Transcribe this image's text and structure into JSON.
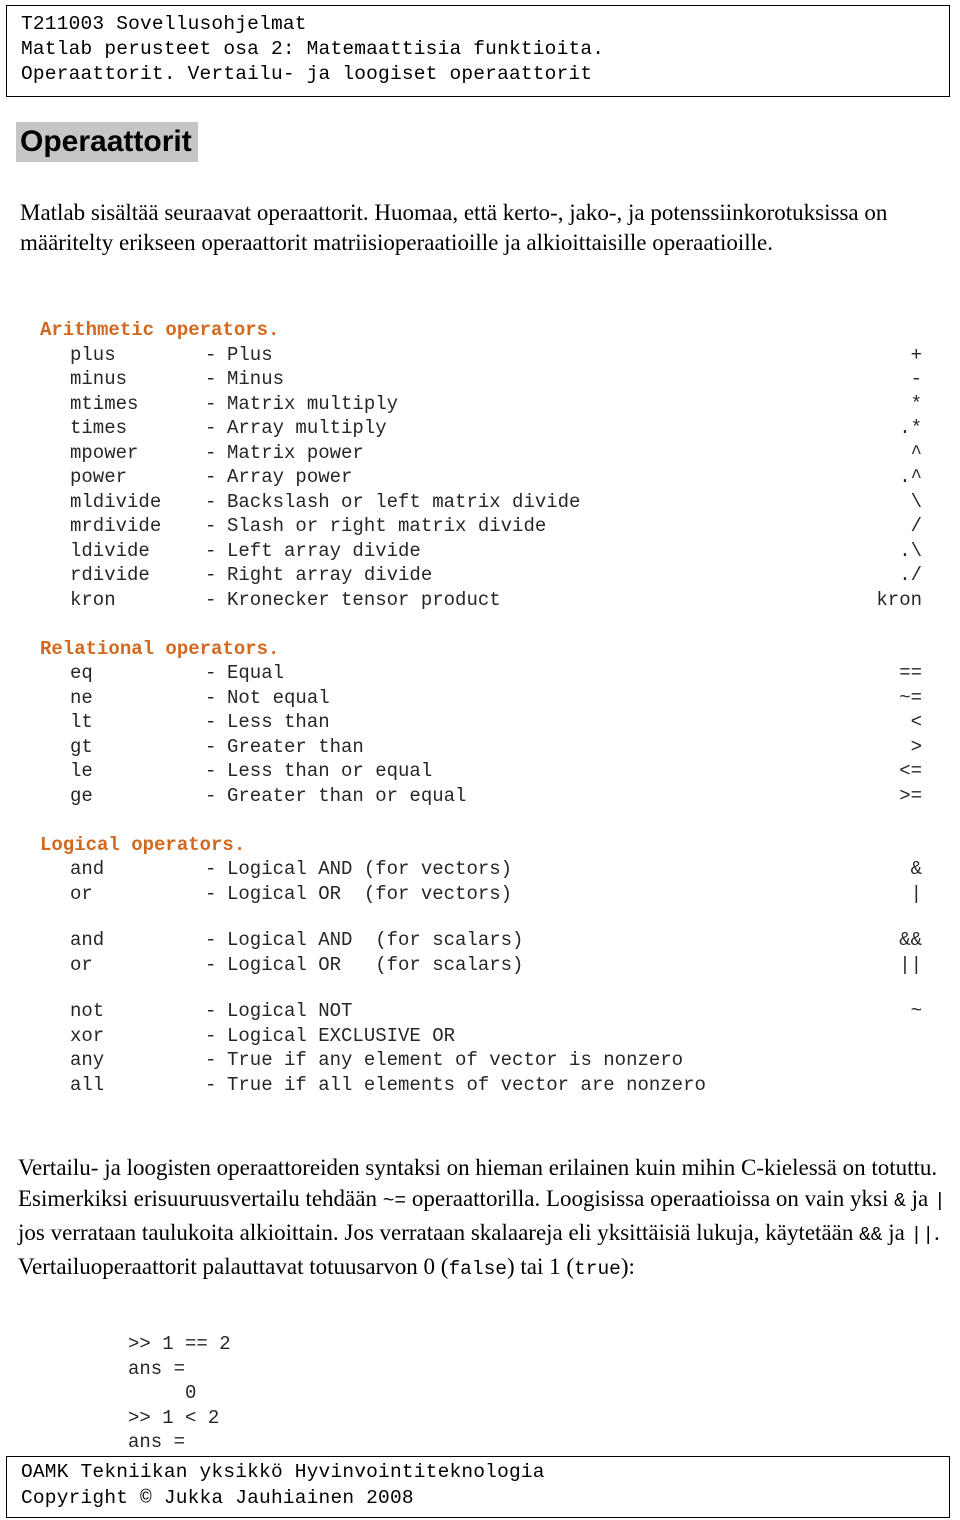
{
  "header": {
    "lines": [
      "T211003 Sovellusohjelmat",
      "Matlab perusteet osa 2: Matemaattisia funktioita.",
      "Operaattorit. Vertailu- ja loogiset operaattorit"
    ]
  },
  "title": "Operaattorit",
  "intro": "Matlab sisältää seuraavat operaattorit. Huomaa, että kerto-, jako-, ja potenssiinkorotuksissa on määritelty erikseen operaattorit matriisioperaatioille ja alkioittaisille operaatioille.",
  "sections": [
    {
      "heading": "Arithmetic operators.",
      "rows": [
        {
          "name": "plus",
          "dash": "-",
          "desc": "Plus",
          "sym": "+"
        },
        {
          "name": "minus",
          "dash": "-",
          "desc": "Minus",
          "sym": "-"
        },
        {
          "name": "mtimes",
          "dash": "-",
          "desc": "Matrix multiply",
          "sym": "*"
        },
        {
          "name": "times",
          "dash": "-",
          "desc": "Array multiply",
          "sym": ".*"
        },
        {
          "name": "mpower",
          "dash": "-",
          "desc": "Matrix power",
          "sym": "^"
        },
        {
          "name": "power",
          "dash": "-",
          "desc": "Array power",
          "sym": ".^"
        },
        {
          "name": "mldivide",
          "dash": "-",
          "desc": "Backslash or left matrix divide",
          "sym": "\\"
        },
        {
          "name": "mrdivide",
          "dash": "-",
          "desc": "Slash or right matrix divide",
          "sym": "/"
        },
        {
          "name": "ldivide",
          "dash": "-",
          "desc": "Left array divide",
          "sym": ".\\"
        },
        {
          "name": "rdivide",
          "dash": "-",
          "desc": "Right array divide",
          "sym": "./"
        },
        {
          "name": "kron",
          "dash": "-",
          "desc": "Kronecker tensor product",
          "sym": "kron"
        }
      ]
    },
    {
      "heading": "Relational operators.",
      "rows": [
        {
          "name": "eq",
          "dash": "-",
          "desc": "Equal",
          "sym": "=="
        },
        {
          "name": "ne",
          "dash": "-",
          "desc": "Not equal",
          "sym": "~="
        },
        {
          "name": "lt",
          "dash": "-",
          "desc": "Less than",
          "sym": "<"
        },
        {
          "name": "gt",
          "dash": "-",
          "desc": "Greater than",
          "sym": ">"
        },
        {
          "name": "le",
          "dash": "-",
          "desc": "Less than or equal",
          "sym": "<="
        },
        {
          "name": "ge",
          "dash": "-",
          "desc": "Greater than or equal",
          "sym": ">="
        }
      ]
    },
    {
      "heading": "Logical operators.",
      "rows": [
        {
          "name": "and",
          "dash": "-",
          "desc": "Logical AND (for vectors)",
          "sym": "&"
        },
        {
          "name": "or",
          "dash": "-",
          "desc": "Logical OR  (for vectors)",
          "sym": "|"
        },
        {
          "name": "",
          "dash": "",
          "desc": "",
          "sym": ""
        },
        {
          "name": "and",
          "dash": "-",
          "desc": "Logical AND  (for scalars)",
          "sym": "&&"
        },
        {
          "name": "or",
          "dash": "-",
          "desc": "Logical OR   (for scalars)",
          "sym": "||"
        },
        {
          "name": "",
          "dash": "",
          "desc": "",
          "sym": ""
        },
        {
          "name": "not",
          "dash": "-",
          "desc": "Logical NOT",
          "sym": "~"
        },
        {
          "name": "xor",
          "dash": "-",
          "desc": "Logical EXCLUSIVE OR",
          "sym": ""
        },
        {
          "name": "any",
          "dash": "-",
          "desc": "True if any element of vector is nonzero",
          "sym": ""
        },
        {
          "name": "all",
          "dash": "-",
          "desc": "True if all elements of vector are nonzero",
          "sym": ""
        }
      ]
    }
  ],
  "closing": {
    "part1": "Vertailu- ja loogisten operaattoreiden syntaksi on hieman erilainen kuin mihin C-kielessä on totuttu. Esimerkiksi erisuuruusvertailu tehdään ",
    "code1": "~=",
    "part2": " operaattorilla. Loogisissa operaatioissa on vain yksi ",
    "code2": "&",
    "part3": " ja ",
    "code3": "|",
    "part4": " jos verrataan taulukoita alkioittain. Jos verrataan skalaareja eli yksittäisiä lukuja, käytetään ",
    "code4": "&&",
    "part5": " ja ",
    "code5": "||",
    "part6": ". Vertailuoperaattorit palauttavat totuusarvon 0 (",
    "code6": "false",
    "part7": ") tai 1 (",
    "code7": "true",
    "part8": "):"
  },
  "console": {
    "lines": [
      ">> 1 == 2",
      "ans =",
      "     0",
      ">> 1 < 2",
      "ans ="
    ]
  },
  "footer": {
    "lines": [
      "OAMK Tekniikan yksikkö Hyvinvointiteknologia",
      "Copyright © Jukka Jauhiainen 2008"
    ]
  },
  "colors": {
    "section_heading": "#d2691e",
    "title_highlight": "#c6c6c6",
    "text": "#000000"
  }
}
